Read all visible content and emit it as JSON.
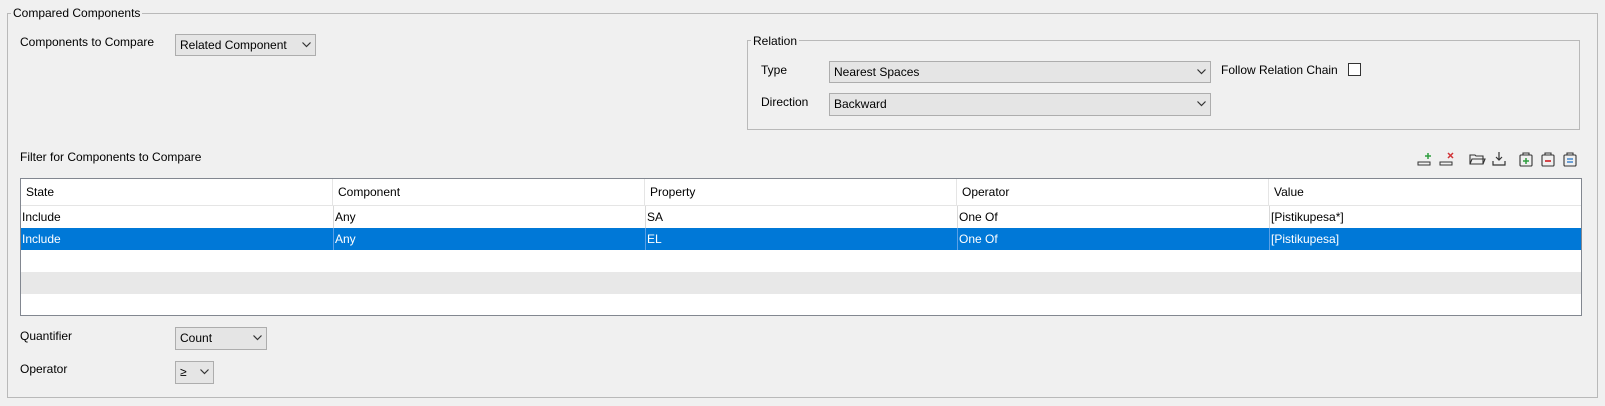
{
  "compared_group": {
    "title": "Compared Components"
  },
  "components_to_compare": {
    "label": "Components to Compare",
    "value": "Related Component"
  },
  "relation": {
    "title": "Relation",
    "type_label": "Type",
    "type_value": "Nearest Spaces",
    "direction_label": "Direction",
    "direction_value": "Backward",
    "follow_chain_label": "Follow Relation Chain",
    "follow_chain_checked": false
  },
  "filter": {
    "title": "Filter for Components to Compare",
    "toolbar_icons": [
      "add-row-icon",
      "remove-row-icon",
      "open-folder-icon",
      "download-icon",
      "add-group-icon",
      "remove-group-icon",
      "clear-group-icon"
    ],
    "columns": [
      "State",
      "Component",
      "Property",
      "Operator",
      "Value"
    ],
    "rows": [
      [
        "Include",
        "Any",
        "SA",
        "One Of",
        "[Pistikupesa*]"
      ],
      [
        "Include",
        "Any",
        "EL",
        "One Of",
        "[Pistikupesa]"
      ]
    ],
    "selected_row": 1
  },
  "quantifier": {
    "label": "Quantifier",
    "value": "Count"
  },
  "operator": {
    "label": "Operator",
    "value": "≥"
  },
  "colors": {
    "selection": "#0078d7",
    "background": "#f0f0f0",
    "add_accent": "#2e9e3e",
    "remove_accent": "#d13438"
  }
}
